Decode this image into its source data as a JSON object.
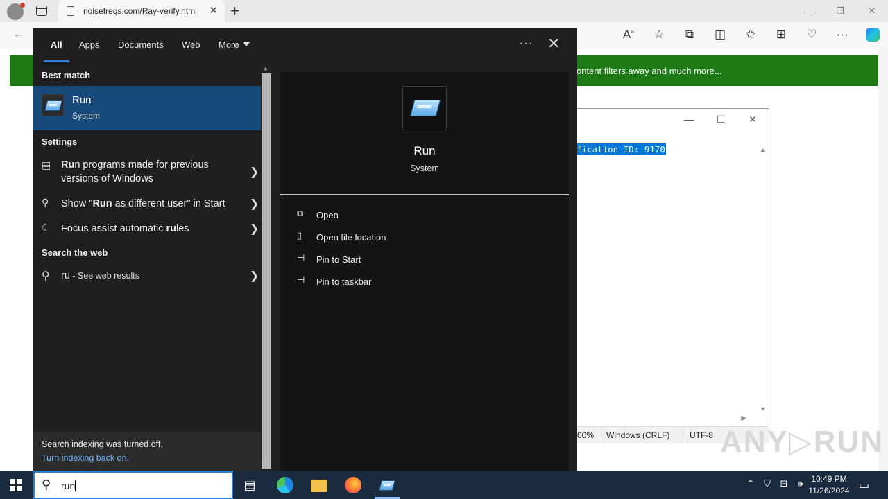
{
  "browser": {
    "tab_title": "noisefreqs.com/Ray-verify.html",
    "tab_close": "✕",
    "new_tab": "+",
    "window_controls": [
      "—",
      "❐",
      "✕"
    ],
    "banner_text": "ontent filters away and much more...",
    "icons": [
      "read-aloud-icon",
      "favorite-star-icon",
      "extensions-icon",
      "split-screen-icon",
      "favorites-icon",
      "collections-icon",
      "browser-essentials-icon",
      "more-icon",
      "copilot-icon"
    ]
  },
  "notepad": {
    "controls": [
      "—",
      "☐",
      "✕"
    ],
    "selected_text": "fication ID: 9170",
    "status": {
      "zoom": "00%",
      "line_endings": "Windows (CRLF)",
      "encoding": "UTF-8"
    }
  },
  "watermark": "ANY RUN",
  "search": {
    "tabs": [
      {
        "label": "All",
        "active": true
      },
      {
        "label": "Apps",
        "active": false
      },
      {
        "label": "Documents",
        "active": false
      },
      {
        "label": "Web",
        "active": false
      },
      {
        "label": "More",
        "active": false
      }
    ],
    "more_options": "···",
    "close": "✕",
    "best_match_heading": "Best match",
    "best_match": {
      "title": "Run",
      "subtitle": "System",
      "icon": "run-icon"
    },
    "settings_heading": "Settings",
    "settings_items": [
      {
        "icon": "compat-icon",
        "pre": "",
        "bold": "Ru",
        "post": "n programs made for previous versions of Windows"
      },
      {
        "icon": "run-as-user-icon",
        "pre": "Show \"",
        "bold": "Run",
        "post": " as different user\" in Start"
      },
      {
        "icon": "moon-icon",
        "pre": "Focus assist automatic ",
        "bold": "ru",
        "post": "les"
      }
    ],
    "web_heading": "Search the web",
    "web_item": {
      "query": "ru",
      "suffix": " - See web results"
    },
    "footer": {
      "line1": "Search indexing was turned off.",
      "link": "Turn indexing back on."
    },
    "preview": {
      "title": "Run",
      "subtitle": "System",
      "actions": [
        {
          "icon": "open-icon",
          "label": "Open"
        },
        {
          "icon": "file-location-icon",
          "label": "Open file location"
        },
        {
          "icon": "pin-icon",
          "label": "Pin to Start"
        },
        {
          "icon": "pin-icon",
          "label": "Pin to taskbar"
        }
      ]
    }
  },
  "taskbar": {
    "search_query": "run",
    "clock_time": "10:49 PM",
    "clock_date": "11/26/2024"
  }
}
